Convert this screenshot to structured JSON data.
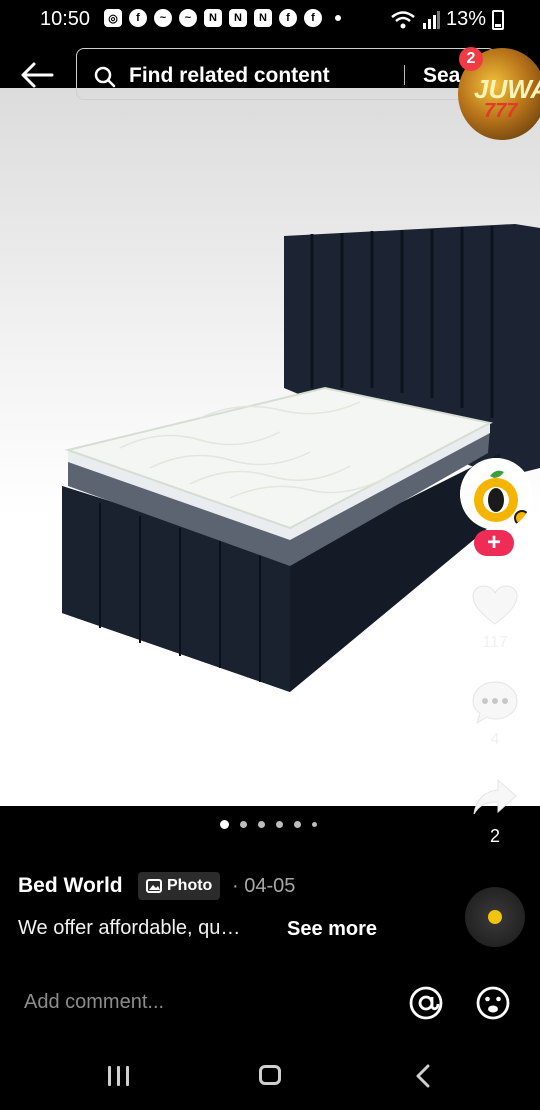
{
  "status_bar": {
    "time": "10:50",
    "battery": "13%"
  },
  "search": {
    "placeholder": "Find related content",
    "button": "Sea"
  },
  "ad": {
    "badge_count": "2",
    "brand_text": "JUWA",
    "brand_num": "777"
  },
  "rail": {
    "likes": "117",
    "comments": "4",
    "shares": "2"
  },
  "carousel": {
    "total": 6,
    "active": 0
  },
  "post": {
    "author": "Bed World",
    "tag": "Photo",
    "date": "· 04-05",
    "caption": "We offer affordable, qu…",
    "see_more": "See more"
  },
  "comment": {
    "placeholder": "Add comment..."
  },
  "colors": {
    "accent_red": "#ef2c55",
    "badge_red": "#ef3b46",
    "music_dot": "#f1c40f"
  }
}
